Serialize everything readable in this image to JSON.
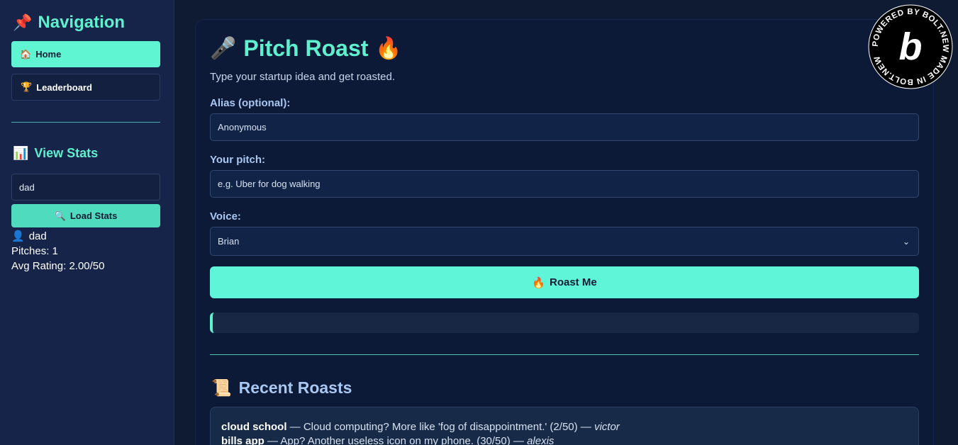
{
  "sidebar": {
    "nav_title": "Navigation",
    "nav_icon": "pushpin-icon",
    "items": [
      {
        "label": "Home",
        "icon": "house-icon"
      },
      {
        "label": "Leaderboard",
        "icon": "trophy-icon"
      }
    ],
    "stats_title": "View Stats",
    "stats_icon": "bar-chart-icon",
    "stats_input_value": "dad",
    "load_button": "Load Stats",
    "result": {
      "name": "dad",
      "pitches": "Pitches: 1",
      "avg_rating": "Avg Rating: 2.00/50"
    }
  },
  "main": {
    "title": "Pitch Roast",
    "subtitle": "Type your startup idea and get roasted.",
    "alias_label": "Alias (optional):",
    "alias_placeholder": "Anonymous",
    "pitch_label": "Your pitch:",
    "pitch_placeholder": "e.g. Uber for dog walking",
    "voice_label": "Voice:",
    "voice_value": "Brian",
    "roast_button": "Roast Me",
    "recent_title": "Recent Roasts",
    "recent": [
      {
        "pitch": "cloud school",
        "roast": " — Cloud computing? More like 'fog of disappointment.' (2/50) — ",
        "alias": "victor"
      },
      {
        "pitch": "bills app",
        "roast": " — App? Another useless icon on my phone. (30/50) — ",
        "alias": "alexis"
      }
    ]
  },
  "badge": {
    "text": "POWERED BY BOLT.NEW MADE IN BOLT.NEW",
    "letter": "b"
  },
  "colors": {
    "accent": "#5ff0cd",
    "background": "#0f1b33",
    "sidebar": "#16244a"
  }
}
